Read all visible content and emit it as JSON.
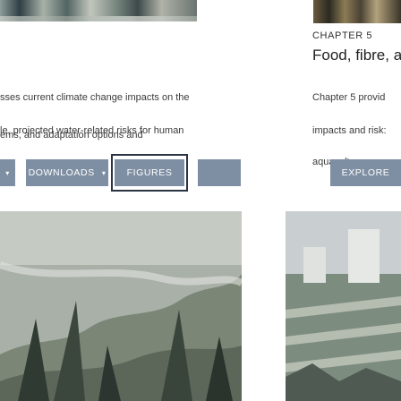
{
  "chapter": {
    "label": "CHAPTER 5",
    "title": "Food, fibre, a",
    "desc_lines": [
      "Chapter 5 provid",
      "impacts and risk:",
      "aquaculture, as w"
    ]
  },
  "left_desc_lines": [
    "sses current climate change impacts on the",
    "le, projected water-related risks for human",
    "ems, and adaptation options and"
  ],
  "buttons": {
    "downloads_label": "DOWNLOADS",
    "figures_label": "FIGURES",
    "explore_label": "EXPLORE",
    "left_edge_caret": "▾",
    "downloads_caret": "▾"
  },
  "colors": {
    "button_bg": "#7f8fa3",
    "button_text": "#ffffff",
    "focus_frame": "#2a3442",
    "text": "#3a3a3a"
  },
  "icons": {
    "dropdown": "chevron-down-icon"
  }
}
